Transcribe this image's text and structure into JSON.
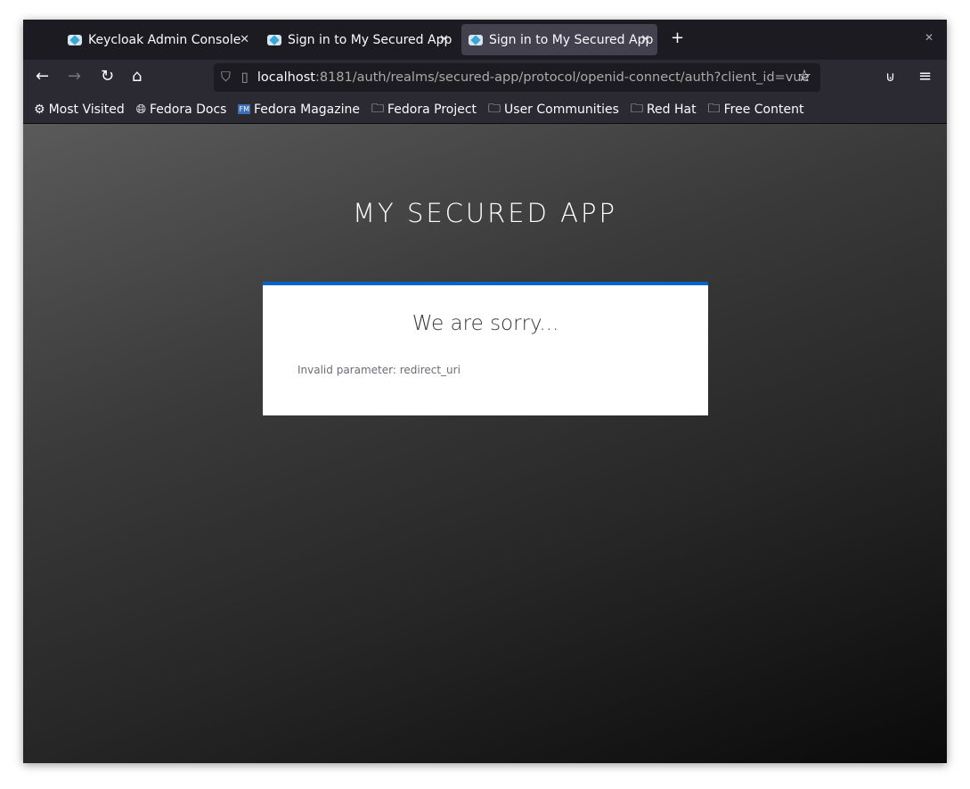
{
  "tabs": [
    {
      "label": "Keycloak Admin Console"
    },
    {
      "label": "Sign in to My Secured App"
    },
    {
      "label": "Sign in to My Secured App",
      "active": true
    }
  ],
  "url": {
    "host": "localhost",
    "rest": ":8181/auth/realms/secured-app/protocol/openid-connect/auth?client_id=vue"
  },
  "bookmarks": [
    {
      "label": "Most Visited",
      "icon": "gear-icon"
    },
    {
      "label": "Fedora Docs",
      "icon": "globe-icon"
    },
    {
      "label": "Fedora Magazine",
      "icon": "fm-icon"
    },
    {
      "label": "Fedora Project",
      "icon": "folder-icon"
    },
    {
      "label": "User Communities",
      "icon": "folder-icon"
    },
    {
      "label": "Red Hat",
      "icon": "folder-icon"
    },
    {
      "label": "Free Content",
      "icon": "folder-icon"
    }
  ],
  "page": {
    "app_title": "MY SECURED APP",
    "heading": "We are sorry...",
    "message": "Invalid parameter: redirect_uri",
    "accent": "#0066cc"
  }
}
